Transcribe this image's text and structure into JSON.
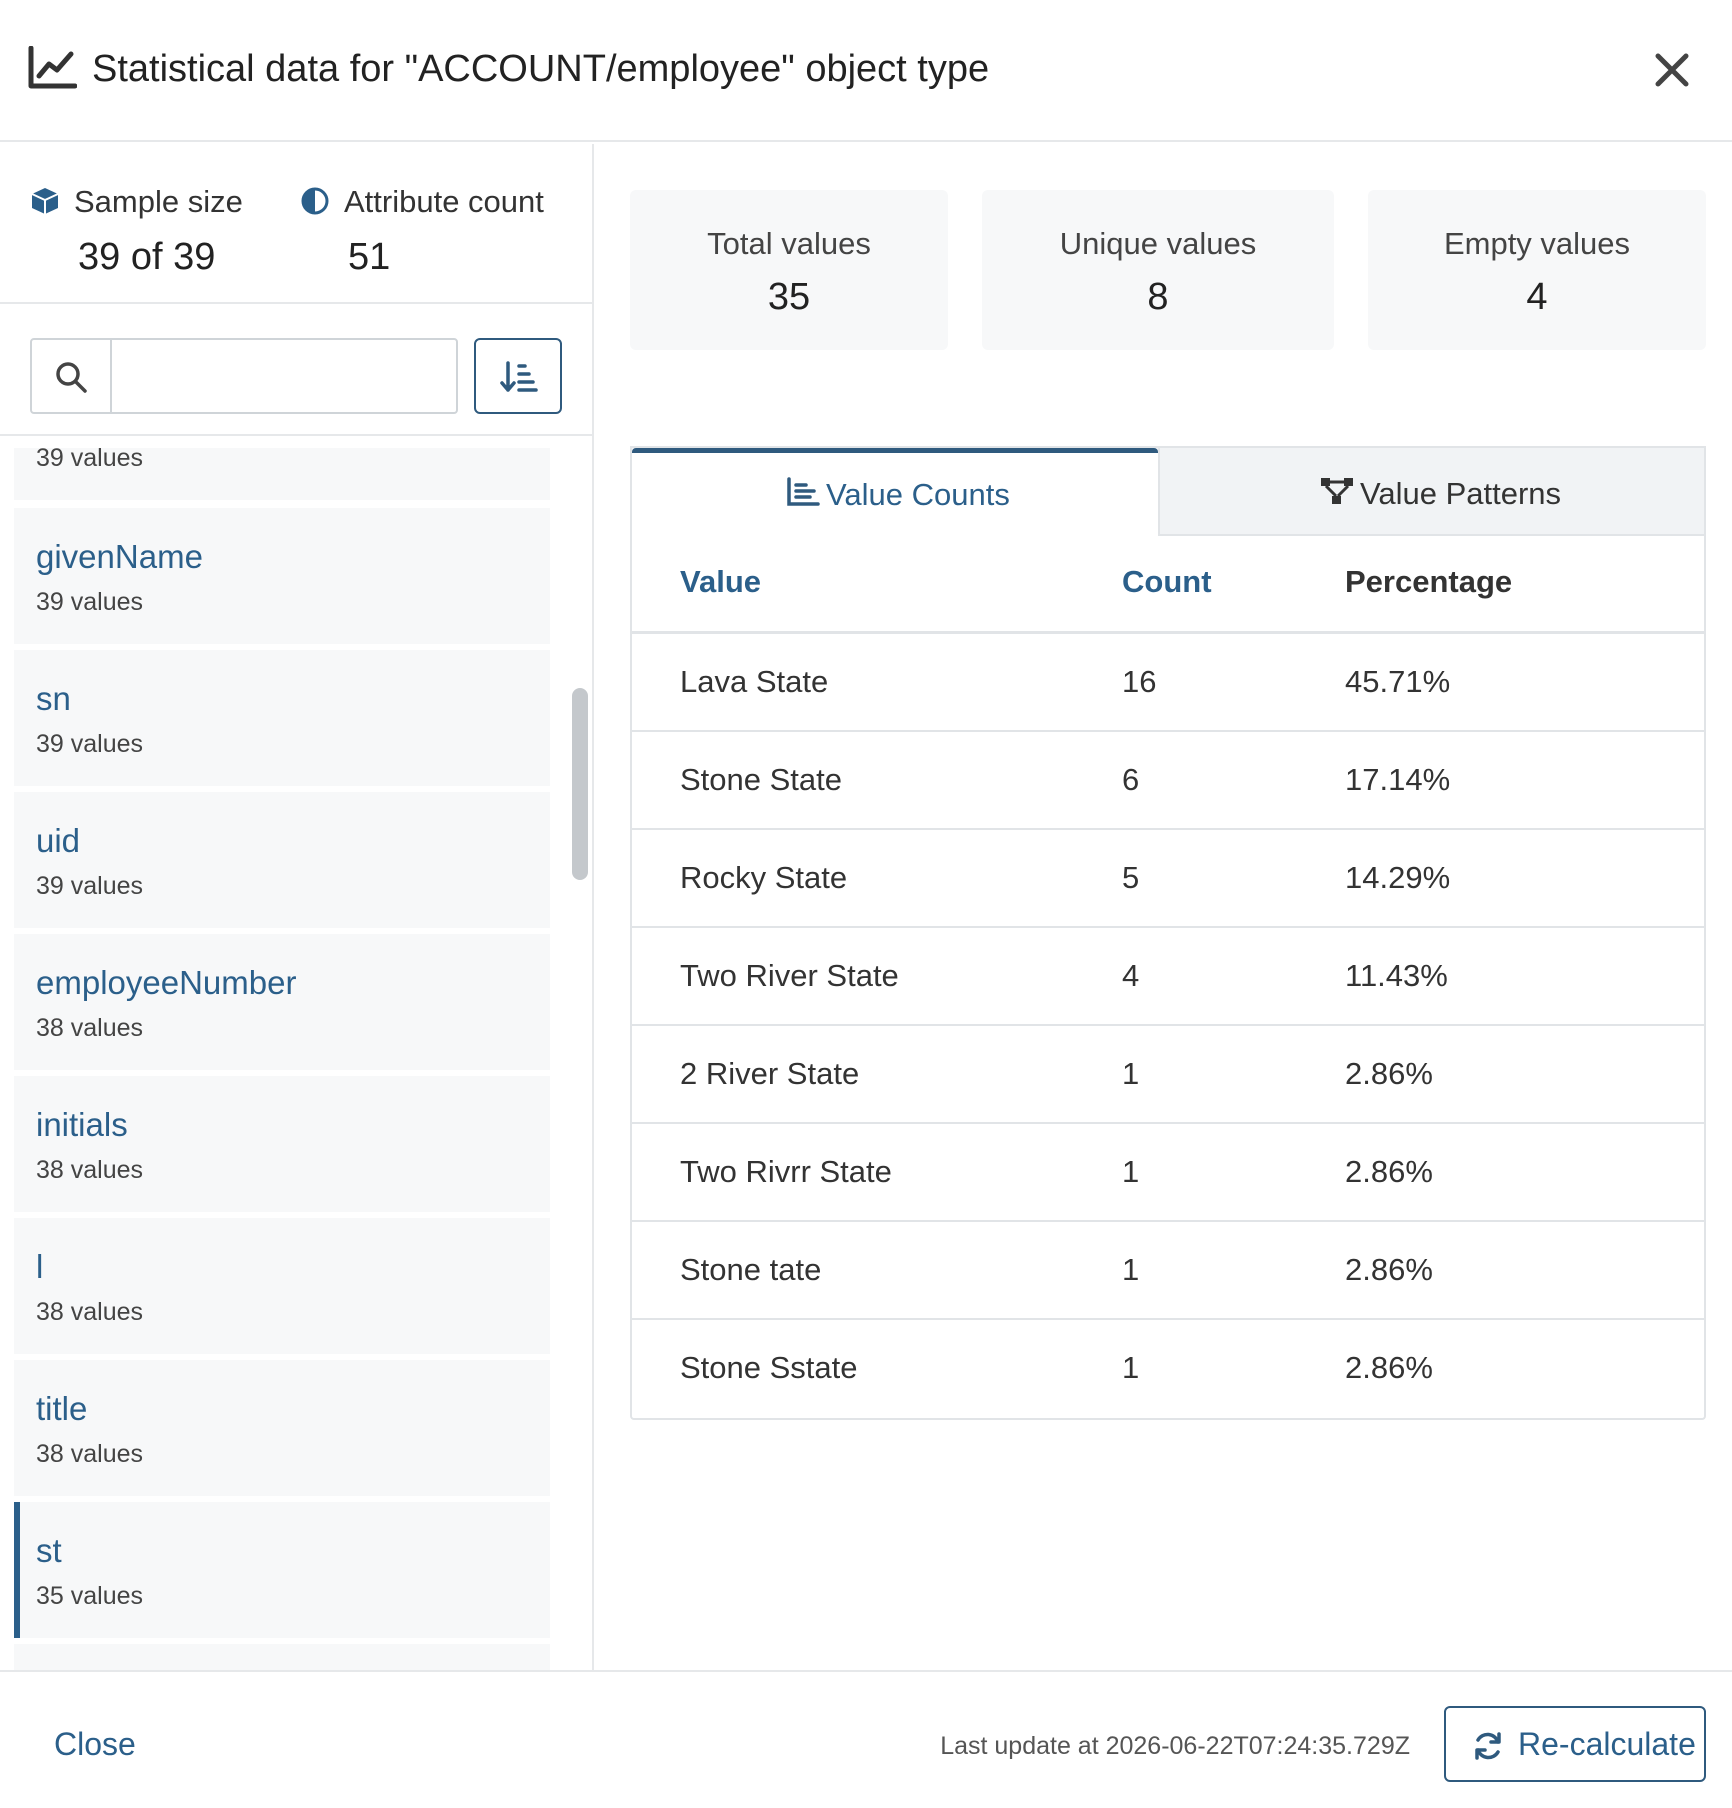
{
  "dialog": {
    "title": "Statistical data for \"ACCOUNT/employee\" object type",
    "title_icon": "line-chart-icon",
    "close_icon": "close-icon"
  },
  "summary": {
    "sample_size_label": "Sample size",
    "sample_size_value": "39 of 39",
    "attribute_count_label": "Attribute count",
    "attribute_count_value": "51"
  },
  "search": {
    "placeholder": "",
    "value": ""
  },
  "attributes": [
    {
      "name": "",
      "count": "39 values"
    },
    {
      "name": "givenName",
      "count": "39 values"
    },
    {
      "name": "sn",
      "count": "39 values"
    },
    {
      "name": "uid",
      "count": "39 values"
    },
    {
      "name": "employeeNumber",
      "count": "38 values"
    },
    {
      "name": "initials",
      "count": "38 values"
    },
    {
      "name": "l",
      "count": "38 values"
    },
    {
      "name": "title",
      "count": "38 values"
    },
    {
      "name": "st",
      "count": "35 values"
    }
  ],
  "selected_attribute": "st",
  "cards": {
    "total_label": "Total values",
    "total_value": "35",
    "unique_label": "Unique values",
    "unique_value": "8",
    "empty_label": "Empty values",
    "empty_value": "4"
  },
  "tabs": {
    "value_counts": "Value Counts",
    "value_patterns": "Value Patterns",
    "active": "value_counts"
  },
  "table": {
    "headers": {
      "value": "Value",
      "count": "Count",
      "percentage": "Percentage"
    },
    "rows": [
      {
        "value": "Lava State",
        "count": "16",
        "percentage": "45.71%"
      },
      {
        "value": "Stone State",
        "count": "6",
        "percentage": "17.14%"
      },
      {
        "value": "Rocky State",
        "count": "5",
        "percentage": "14.29%"
      },
      {
        "value": "Two River State",
        "count": "4",
        "percentage": "11.43%"
      },
      {
        "value": "2 River State",
        "count": "1",
        "percentage": "2.86%"
      },
      {
        "value": "Two Rivrr State",
        "count": "1",
        "percentage": "2.86%"
      },
      {
        "value": "Stone tate",
        "count": "1",
        "percentage": "2.86%"
      },
      {
        "value": "Stone Sstate",
        "count": "1",
        "percentage": "2.86%"
      }
    ]
  },
  "footer": {
    "close_label": "Close",
    "last_update": "Last update at 2026-06-22T07:24:35.729Z",
    "recalculate_label": "Re-calculate"
  },
  "colors": {
    "accent": "#2f5a7e",
    "link": "#2b5f8a",
    "card_bg": "#f7f8f9",
    "border": "#e1e4e7"
  }
}
